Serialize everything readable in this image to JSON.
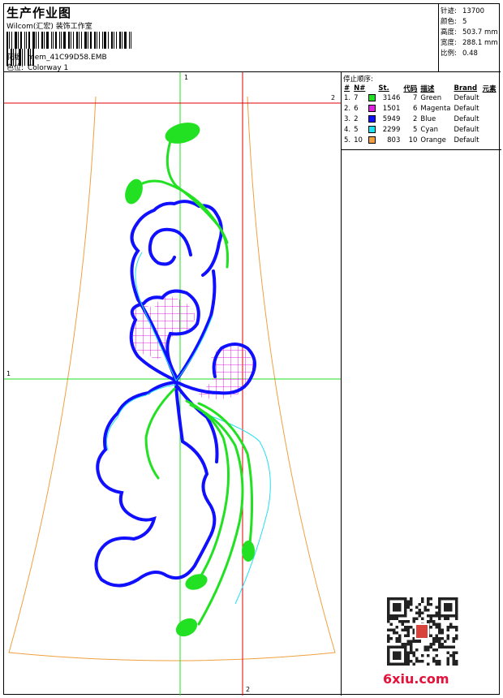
{
  "header": {
    "title": "生产作业图",
    "company": "Wilcom(汇宏) 装饰工作室",
    "design_label": "花版:",
    "design_value": "mem_41C99D58.EMB",
    "colorway_label": "色位:",
    "colorway_value": "Colorway 1"
  },
  "stats": {
    "stitches_label": "针迹:",
    "stitches_value": "13700",
    "colors_label": "颜色:",
    "colors_value": "5",
    "height_label": "高度:",
    "height_value": "503.7 mm",
    "width_label": "宽度:",
    "width_value": "288.1 mm",
    "scale_label": "比例:",
    "scale_value": "0.48"
  },
  "stop_table": {
    "title": "停止顺序:",
    "headers": [
      "#",
      "N#",
      "St.",
      "代码",
      "描述",
      "Brand",
      "元素"
    ],
    "rows": [
      {
        "idx": "1.",
        "n": "7",
        "st": "3146",
        "code": "7",
        "desc": "Green",
        "brand": "Default",
        "color": "#22e022"
      },
      {
        "idx": "2.",
        "n": "6",
        "st": "1501",
        "code": "6",
        "desc": "Magenta",
        "brand": "Default",
        "color": "#e020e0"
      },
      {
        "idx": "3.",
        "n": "2",
        "st": "5949",
        "code": "2",
        "desc": "Blue",
        "brand": "Default",
        "color": "#1010ff"
      },
      {
        "idx": "4.",
        "n": "5",
        "st": "2299",
        "code": "5",
        "desc": "Cyan",
        "brand": "Default",
        "color": "#20e0f0"
      },
      {
        "idx": "5.",
        "n": "10",
        "st": "803",
        "code": "10",
        "desc": "Orange",
        "brand": "Default",
        "color": "#f0a040"
      }
    ]
  },
  "canvas": {
    "axis_labels": [
      "1",
      "2",
      "1",
      "2"
    ],
    "colors": {
      "green": "#22e022",
      "blue": "#1010ff",
      "magenta": "#e020e0",
      "cyan": "#20e0f0",
      "orange": "#f0a040",
      "red_line": "#e00000"
    }
  },
  "watermark": {
    "site": "6xiu.com"
  }
}
